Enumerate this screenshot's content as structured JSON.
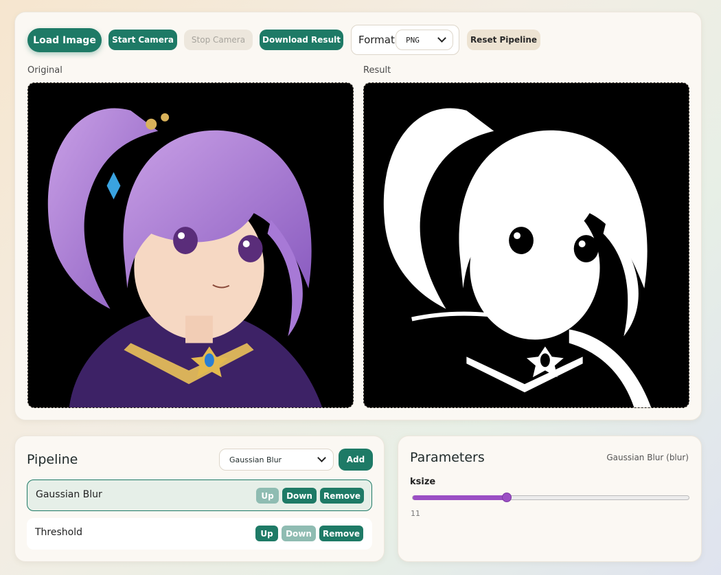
{
  "toolbar": {
    "load_label": "Load Image",
    "start_camera_label": "Start Camera",
    "stop_camera_label": "Stop Camera",
    "download_label": "Download Result",
    "format_label": "Format",
    "format_value": "PNG",
    "reset_label": "Reset Pipeline"
  },
  "panels": {
    "original_label": "Original",
    "result_label": "Result"
  },
  "pipeline": {
    "title": "Pipeline",
    "selected_step": "Gaussian Blur",
    "add_label": "Add",
    "steps": [
      {
        "name": "Gaussian Blur",
        "active": true,
        "up_label": "Up",
        "down_label": "Down",
        "remove_label": "Remove"
      },
      {
        "name": "Threshold",
        "active": false,
        "up_label": "Up",
        "down_label": "Down",
        "remove_label": "Remove"
      }
    ]
  },
  "parameters": {
    "title": "Parameters",
    "subtitle": "Gaussian Blur (blur)",
    "param_name": "ksize",
    "param_value": "11",
    "slider_fraction": 0.34
  },
  "colors": {
    "accent": "#1e7a66",
    "slider": "#9b4fc4"
  }
}
